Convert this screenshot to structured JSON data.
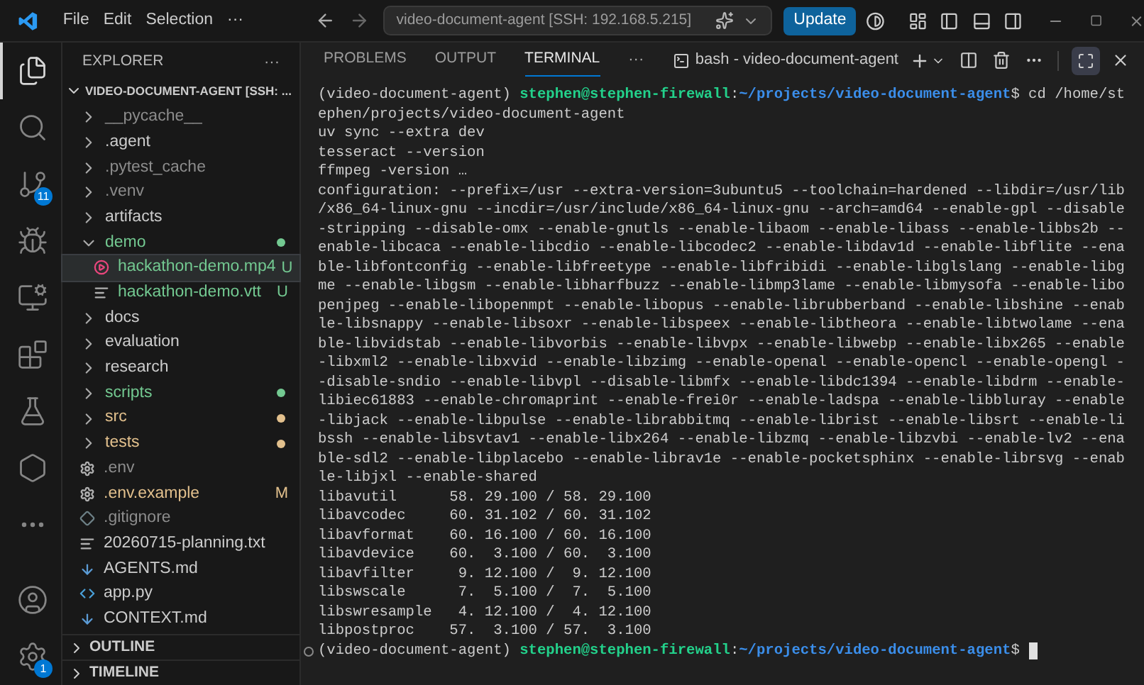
{
  "title_bar": {
    "menus": [
      "File",
      "Edit",
      "Selection",
      "···"
    ],
    "search": "video-document-agent [SSH: 192.168.5.215]",
    "update_button": "Update"
  },
  "activity_bar": {
    "items": [
      {
        "kind": "explorer",
        "selected": true
      },
      {
        "kind": "search",
        "selected": false
      },
      {
        "kind": "source-control",
        "selected": false,
        "badge": "11"
      },
      {
        "kind": "run-debug",
        "selected": false
      },
      {
        "kind": "remote",
        "selected": false
      },
      {
        "kind": "extensions",
        "selected": false
      },
      {
        "kind": "testing",
        "selected": false
      },
      {
        "kind": "hexagon",
        "selected": false
      },
      {
        "kind": "more",
        "selected": false
      }
    ],
    "bottom": [
      {
        "kind": "account"
      },
      {
        "kind": "settings",
        "badge": "1"
      }
    ]
  },
  "sidebar": {
    "title": "EXPLORER",
    "more": "···",
    "root": {
      "label": "VIDEO-DOCUMENT-AGENT [SSH: ...",
      "expanded": true
    },
    "items": [
      {
        "kind": "folder",
        "label": "__pycache__",
        "color": "#8c8c8c",
        "expanded": false,
        "dot": false,
        "selected": false
      },
      {
        "kind": "folder",
        "label": ".agent",
        "color": "#cccccc",
        "expanded": false,
        "dot": false,
        "selected": false
      },
      {
        "kind": "folder",
        "label": ".pytest_cache",
        "color": "#8c8c8c",
        "expanded": false,
        "dot": false,
        "selected": false
      },
      {
        "kind": "folder",
        "label": ".venv",
        "color": "#8c8c8c",
        "expanded": false,
        "dot": false,
        "selected": false
      },
      {
        "kind": "folder",
        "label": "artifacts",
        "color": "#cccccc",
        "expanded": false,
        "dot": false,
        "selected": false
      },
      {
        "kind": "folder",
        "label": "demo",
        "color": "#73c991",
        "expanded": true,
        "dot": true,
        "selected": false,
        "children": [
          {
            "kind": "video",
            "label": "hackathon-demo.mp4",
            "color": "#73c991",
            "badge": "U",
            "selected": true
          },
          {
            "kind": "lines",
            "label": "hackathon-demo.vtt",
            "color": "#73c991",
            "badge": "U",
            "selected": false
          }
        ]
      },
      {
        "kind": "folder",
        "label": "docs",
        "color": "#cccccc",
        "expanded": false,
        "dot": false,
        "selected": false
      },
      {
        "kind": "folder",
        "label": "evaluation",
        "color": "#cccccc",
        "expanded": false,
        "dot": false,
        "selected": false
      },
      {
        "kind": "folder",
        "label": "research",
        "color": "#cccccc",
        "expanded": false,
        "dot": false,
        "selected": false
      },
      {
        "kind": "folder",
        "label": "scripts",
        "color": "#73c991",
        "expanded": false,
        "dot": true,
        "selected": false
      },
      {
        "kind": "folder",
        "label": "src",
        "color": "#e2c08d",
        "expanded": false,
        "dot": true,
        "selected": false
      },
      {
        "kind": "folder",
        "label": "tests",
        "color": "#e2c08d",
        "expanded": false,
        "dot": true,
        "selected": false
      },
      {
        "kind": "gear",
        "label": ".env",
        "color": "#8c8c8c",
        "selected": false
      },
      {
        "kind": "gear",
        "label": ".env.example",
        "color": "#e2c08d",
        "badge": "M",
        "selected": false
      },
      {
        "kind": "diamond",
        "label": ".gitignore",
        "color": "#8c8c8c",
        "selected": false
      },
      {
        "kind": "lines",
        "label": "20260715-planning.txt",
        "color": "#cccccc",
        "selected": false
      },
      {
        "kind": "markdown",
        "label": "AGENTS.md",
        "color": "#cccccc",
        "selected": false
      },
      {
        "kind": "python",
        "label": "app.py",
        "color": "#cccccc",
        "selected": false
      },
      {
        "kind": "markdown",
        "label": "CONTEXT.md",
        "color": "#cccccc",
        "selected": false
      }
    ],
    "sections": [
      {
        "label": "OUTLINE",
        "expanded": false
      },
      {
        "label": "TIMELINE",
        "expanded": false
      }
    ]
  },
  "panel": {
    "tabs": [
      {
        "label": "PROBLEMS",
        "selected": false
      },
      {
        "label": "OUTPUT",
        "selected": false
      },
      {
        "label": "TERMINAL",
        "selected": true
      }
    ],
    "more": "···",
    "terminal_name": "bash - video-document-agent",
    "lines": [
      {
        "kind": "prompt",
        "segments": [
          {
            "text": "(video-document-agent) ",
            "kind": "plain"
          },
          {
            "text": "stephen@stephen-firewall",
            "kind": "user"
          },
          {
            "text": ":",
            "kind": "plain"
          },
          {
            "text": "~/projects/video-document-agent",
            "kind": "path"
          },
          {
            "text": "$ cd /home/st",
            "kind": "plain"
          }
        ]
      },
      {
        "kind": "output",
        "text": "ephen/projects/video-document-agent"
      },
      {
        "kind": "output",
        "text": "uv sync --extra dev"
      },
      {
        "kind": "output",
        "text": "tesseract --version"
      },
      {
        "kind": "output",
        "text": "ffmpeg -version …"
      },
      {
        "kind": "output",
        "text": "configuration: --prefix=/usr --extra-version=3ubuntu5 --toolchain=hardened --libdir=/usr/lib"
      },
      {
        "kind": "output",
        "text": "/x86_64-linux-gnu --incdir=/usr/include/x86_64-linux-gnu --arch=amd64 --enable-gpl --disable"
      },
      {
        "kind": "output",
        "text": "-stripping --disable-omx --enable-gnutls --enable-libaom --enable-libass --enable-libbs2b --"
      },
      {
        "kind": "output",
        "text": "enable-libcaca --enable-libcdio --enable-libcodec2 --enable-libdav1d --enable-libflite --ena"
      },
      {
        "kind": "output",
        "text": "ble-libfontconfig --enable-libfreetype --enable-libfribidi --enable-libglslang --enable-libg"
      },
      {
        "kind": "output",
        "text": "me --enable-libgsm --enable-libharfbuzz --enable-libmp3lame --enable-libmysofa --enable-libo"
      },
      {
        "kind": "output",
        "text": "penjpeg --enable-libopenmpt --enable-libopus --enable-librubberband --enable-libshine --enab"
      },
      {
        "kind": "output",
        "text": "le-libsnappy --enable-libsoxr --enable-libspeex --enable-libtheora --enable-libtwolame --ena"
      },
      {
        "kind": "output",
        "text": "ble-libvidstab --enable-libvorbis --enable-libvpx --enable-libwebp --enable-libx265 --enable"
      },
      {
        "kind": "output",
        "text": "-libxml2 --enable-libxvid --enable-libzimg --enable-openal --enable-opencl --enable-opengl -"
      },
      {
        "kind": "output",
        "text": "-disable-sndio --enable-libvpl --disable-libmfx --enable-libdc1394 --enable-libdrm --enable-"
      },
      {
        "kind": "output",
        "text": "libiec61883 --enable-chromaprint --enable-frei0r --enable-ladspa --enable-libbluray --enable"
      },
      {
        "kind": "output",
        "text": "-libjack --enable-libpulse --enable-librabbitmq --enable-librist --enable-libsrt --enable-li"
      },
      {
        "kind": "output",
        "text": "bssh --enable-libsvtav1 --enable-libx264 --enable-libzmq --enable-libzvbi --enable-lv2 --ena"
      },
      {
        "kind": "output",
        "text": "ble-sdl2 --enable-libplacebo --enable-librav1e --enable-pocketsphinx --enable-librsvg --enab"
      },
      {
        "kind": "output",
        "text": "le-libjxl --enable-shared"
      },
      {
        "kind": "output",
        "text": "libavutil      58. 29.100 / 58. 29.100"
      },
      {
        "kind": "output",
        "text": "libavcodec     60. 31.102 / 60. 31.102"
      },
      {
        "kind": "output",
        "text": "libavformat    60. 16.100 / 60. 16.100"
      },
      {
        "kind": "output",
        "text": "libavdevice    60.  3.100 / 60.  3.100"
      },
      {
        "kind": "output",
        "text": "libavfilter     9. 12.100 /  9. 12.100"
      },
      {
        "kind": "output",
        "text": "libswscale      7.  5.100 /  7.  5.100"
      },
      {
        "kind": "output",
        "text": "libswresample   4. 12.100 /  4. 12.100"
      },
      {
        "kind": "output",
        "text": "libpostproc    57.  3.100 / 57.  3.100"
      },
      {
        "kind": "prompt",
        "cursor": true,
        "segments": [
          {
            "text": "(video-document-agent) ",
            "kind": "plain"
          },
          {
            "text": "stephen@stephen-firewall",
            "kind": "user"
          },
          {
            "text": ":",
            "kind": "plain"
          },
          {
            "text": "~/projects/video-document-agent",
            "kind": "path"
          },
          {
            "text": "$",
            "kind": "plain"
          }
        ]
      }
    ]
  }
}
